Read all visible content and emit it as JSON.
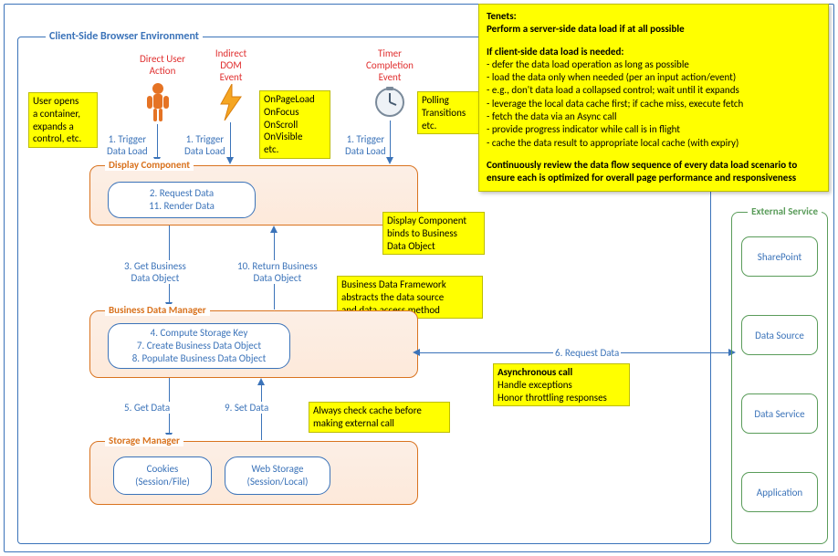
{
  "env_title": "Client-Side Browser Environment",
  "triggers": {
    "direct": "Direct User\nAction",
    "indirect": "Indirect\nDOM\nEvent",
    "timer": "Timer\nCompletion\nEvent",
    "trigger_label": "1. Trigger\nData Load"
  },
  "notes": {
    "user_opens": "User opens\na container,\nexpands a\ncontrol, etc.",
    "dom_events": "OnPageLoad\nOnFocus\nOnScroll\nOnVisible\netc.",
    "polling": "Polling\nTransitions\netc.",
    "display_binds": "Display Component\nbinds to Business\nData Object",
    "bdf_abstracts": "Business Data Framework\nabstracts the data source\nand data access method",
    "async_call": "Asynchronous call\nHandle exceptions\nHonor throttling responses",
    "check_cache": "Always check cache before\nmaking external call"
  },
  "components": {
    "display": {
      "title": "Display Component",
      "items": [
        "2. Request Data",
        "11. Render Data"
      ]
    },
    "bdm": {
      "title": "Business Data Manager",
      "items": [
        "4. Compute Storage Key",
        "7. Create Business Data Object",
        "8. Populate Business Data Object"
      ]
    },
    "storage": {
      "title": "Storage Manager",
      "cookies": "Cookies\n(Session/File)",
      "webstorage": "Web Storage\n(Session/Local)"
    }
  },
  "flows": {
    "get_bdo": "3. Get Business\nData Object",
    "return_bdo": "10. Return Business\nData Object",
    "get_data": "5. Get Data",
    "set_data": "9. Set Data",
    "request_data": "6. Request Data"
  },
  "external": {
    "title": "External Service",
    "items": [
      "SharePoint",
      "Data Source",
      "Data Service",
      "Application"
    ]
  },
  "tenets": {
    "heading": "Tenets:",
    "line1": "Perform a server-side data load if at all possible",
    "line2": "If client-side data load is needed:",
    "b1": "- defer the data load operation as long as possible",
    "b2": "- load the data only when needed (per an input action/event)",
    "b3": "-  e.g., don't data load a collapsed control; wait until it expands",
    "b4": "- leverage the local data cache first; if cache miss, execute fetch",
    "b5": "- fetch the data via an Async call",
    "b6": "- provide progress indicator while call is in flight",
    "b7": "- cache the data result to appropriate local cache (with expiry)",
    "line3": "Continuously review the data flow sequence of every data load scenario to ensure each is optimized for overall page performance and responsiveness"
  }
}
